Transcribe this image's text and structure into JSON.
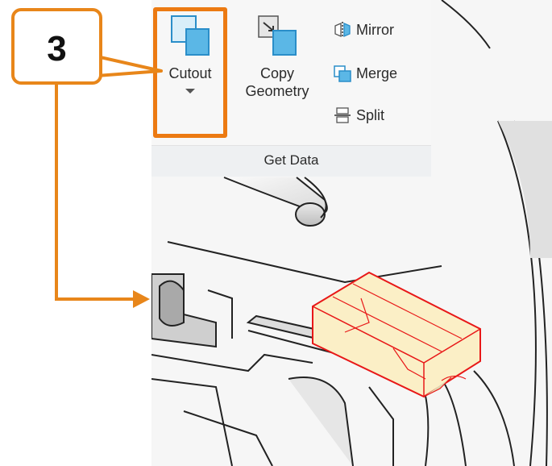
{
  "callout": {
    "number": "3"
  },
  "ribbon": {
    "group_label": "Get Data",
    "cutout": {
      "label": "Cutout",
      "icon": "cutout-icon"
    },
    "copy_geometry": {
      "label_line1": "Copy",
      "label_line2": "Geometry",
      "icon": "copy-geometry-icon"
    },
    "mirror": {
      "label": "Mirror",
      "icon": "mirror-icon"
    },
    "merge": {
      "label": "Merge",
      "icon": "merge-icon"
    },
    "split": {
      "label": "Split",
      "icon": "split-icon"
    }
  },
  "colors": {
    "accent_orange": "#ec7a12",
    "selection_red": "#e81818",
    "selection_fill": "#fbefc6",
    "icon_blue": "#5bb7e6"
  }
}
